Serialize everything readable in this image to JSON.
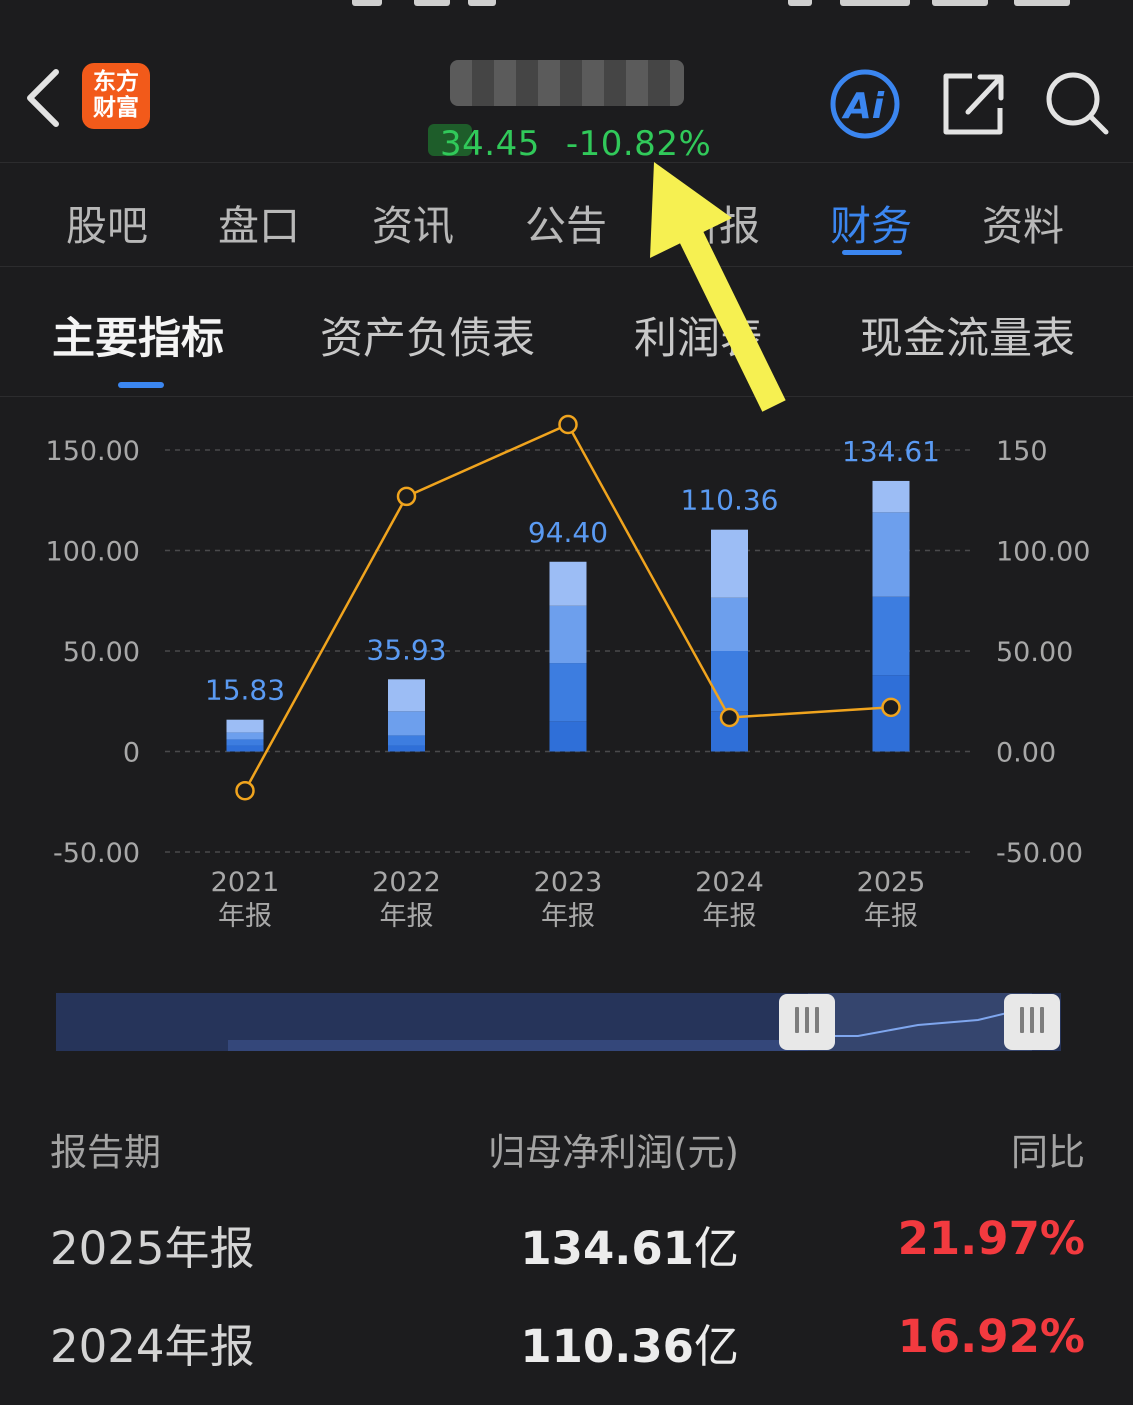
{
  "header": {
    "logo_line1": "东方",
    "logo_line2": "财富",
    "price": "34.45",
    "change_pct": "-10.82%",
    "icons": {
      "back": "chevron-left-icon",
      "ai": "ai-assistant-icon",
      "share": "share-icon",
      "search": "search-icon"
    },
    "colors": {
      "logo_bg": "#f25a1a",
      "quote_down": "#31c95a",
      "accent": "#3b86f0"
    }
  },
  "tabs": [
    {
      "label": "股吧"
    },
    {
      "label": "盘口"
    },
    {
      "label": "资讯"
    },
    {
      "label": "公告"
    },
    {
      "label": "研报"
    },
    {
      "label": "财务",
      "active": true
    },
    {
      "label": "资料"
    }
  ],
  "subtabs": [
    {
      "label": "主要指标",
      "active": true
    },
    {
      "label": "资产负债表"
    },
    {
      "label": "利润表"
    },
    {
      "label": "现金流量表"
    }
  ],
  "chart_data": {
    "type": "bar",
    "categories": [
      "2021\n年报",
      "2022\n年报",
      "2023\n年报",
      "2024\n年报",
      "2025\n年报"
    ],
    "series": [
      {
        "type": "bar",
        "values": [
          15.83,
          35.93,
          94.4,
          110.36,
          134.61
        ]
      },
      {
        "type": "line",
        "axis": "right",
        "values": [
          -19.5,
          126.9,
          162.7,
          16.92,
          21.97
        ]
      }
    ],
    "bar_segments": [
      [
        3.0,
        3.0,
        3.5,
        6.33
      ],
      [
        3.0,
        5.0,
        12.0,
        15.93
      ],
      [
        15.0,
        29.0,
        28.5,
        21.9
      ],
      [
        20.0,
        30.0,
        26.5,
        33.86
      ],
      [
        38.0,
        39.0,
        42.0,
        15.61
      ]
    ],
    "bar_labels": [
      "15.83",
      "35.93",
      "94.40",
      "110.36",
      "134.61"
    ],
    "left_axis": {
      "ticks": [
        "150.00",
        "100.00",
        "50.00",
        "0",
        "-50.00"
      ],
      "ylim": [
        -50,
        150
      ]
    },
    "right_axis": {
      "ticks": [
        "150",
        "100.00",
        "50.00",
        "0.00",
        "-50.00"
      ],
      "ylim": [
        -50,
        150
      ]
    },
    "grid": true,
    "colors": {
      "segments": [
        "#2f6fd8",
        "#3d7de0",
        "#6d9fed",
        "#9cbdf5"
      ],
      "line": "#f0a41e",
      "label": "#5a9af2",
      "axis_text": "#a8a8a8"
    }
  },
  "table": {
    "headers": {
      "period": "报告期",
      "value": "归母净利润(元)",
      "yoy": "同比"
    },
    "rows": [
      {
        "period": "2025年报",
        "value": "134.61",
        "unit": "亿",
        "yoy": "21.97%"
      },
      {
        "period": "2024年报",
        "value": "110.36",
        "unit": "亿",
        "yoy": "16.92%"
      }
    ]
  }
}
